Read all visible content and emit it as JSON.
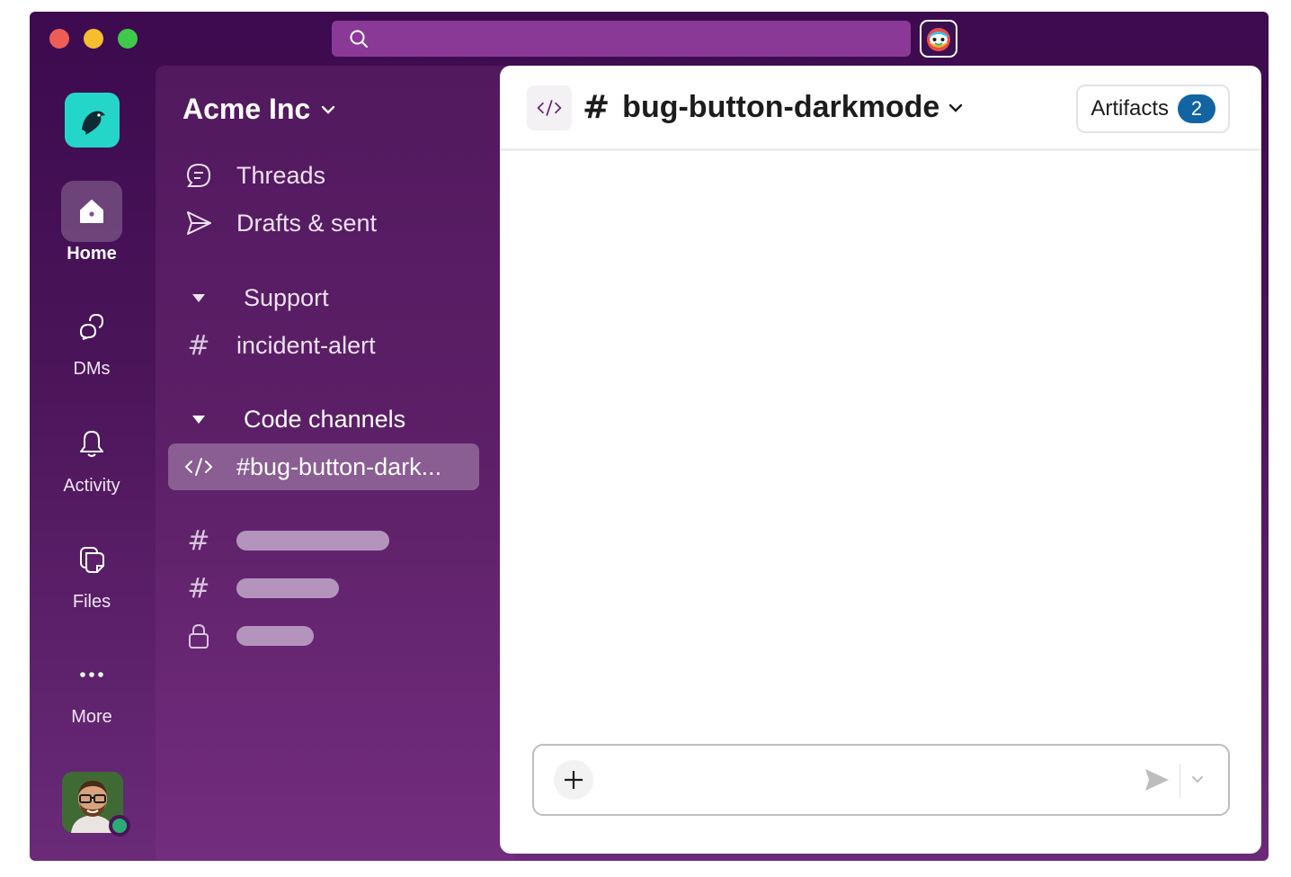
{
  "workspace": {
    "name": "Acme Inc"
  },
  "rail": {
    "items": [
      {
        "label": "Home",
        "icon": "home-icon"
      },
      {
        "label": "DMs",
        "icon": "dms-icon"
      },
      {
        "label": "Activity",
        "icon": "bell-icon"
      },
      {
        "label": "Files",
        "icon": "files-icon"
      },
      {
        "label": "More",
        "icon": "more-icon"
      }
    ]
  },
  "sidebar": {
    "top_items": [
      {
        "label": "Threads",
        "icon": "threads-icon"
      },
      {
        "label": "Drafts & sent",
        "icon": "send-icon"
      }
    ],
    "sections": [
      {
        "label": "Support",
        "channels": [
          {
            "label": "incident-alert",
            "icon": "hash-icon"
          }
        ]
      },
      {
        "label": "Code channels",
        "channels": [
          {
            "label": "#bug-button-dark...",
            "icon": "code-icon",
            "active": true
          }
        ]
      }
    ],
    "placeholder_channels": [
      {
        "icon": "hash-icon"
      },
      {
        "icon": "hash-icon"
      },
      {
        "icon": "lock-icon"
      }
    ]
  },
  "channel": {
    "name": "bug-button-darkmode",
    "artifacts_label": "Artifacts",
    "artifacts_count": "2"
  },
  "colors": {
    "window_bg": "#3d0a4f",
    "sidebar_bg": "#5d2068",
    "accent_teal": "#23d6c8",
    "badge_blue": "#1264a3",
    "presence_green": "#2bac76"
  }
}
